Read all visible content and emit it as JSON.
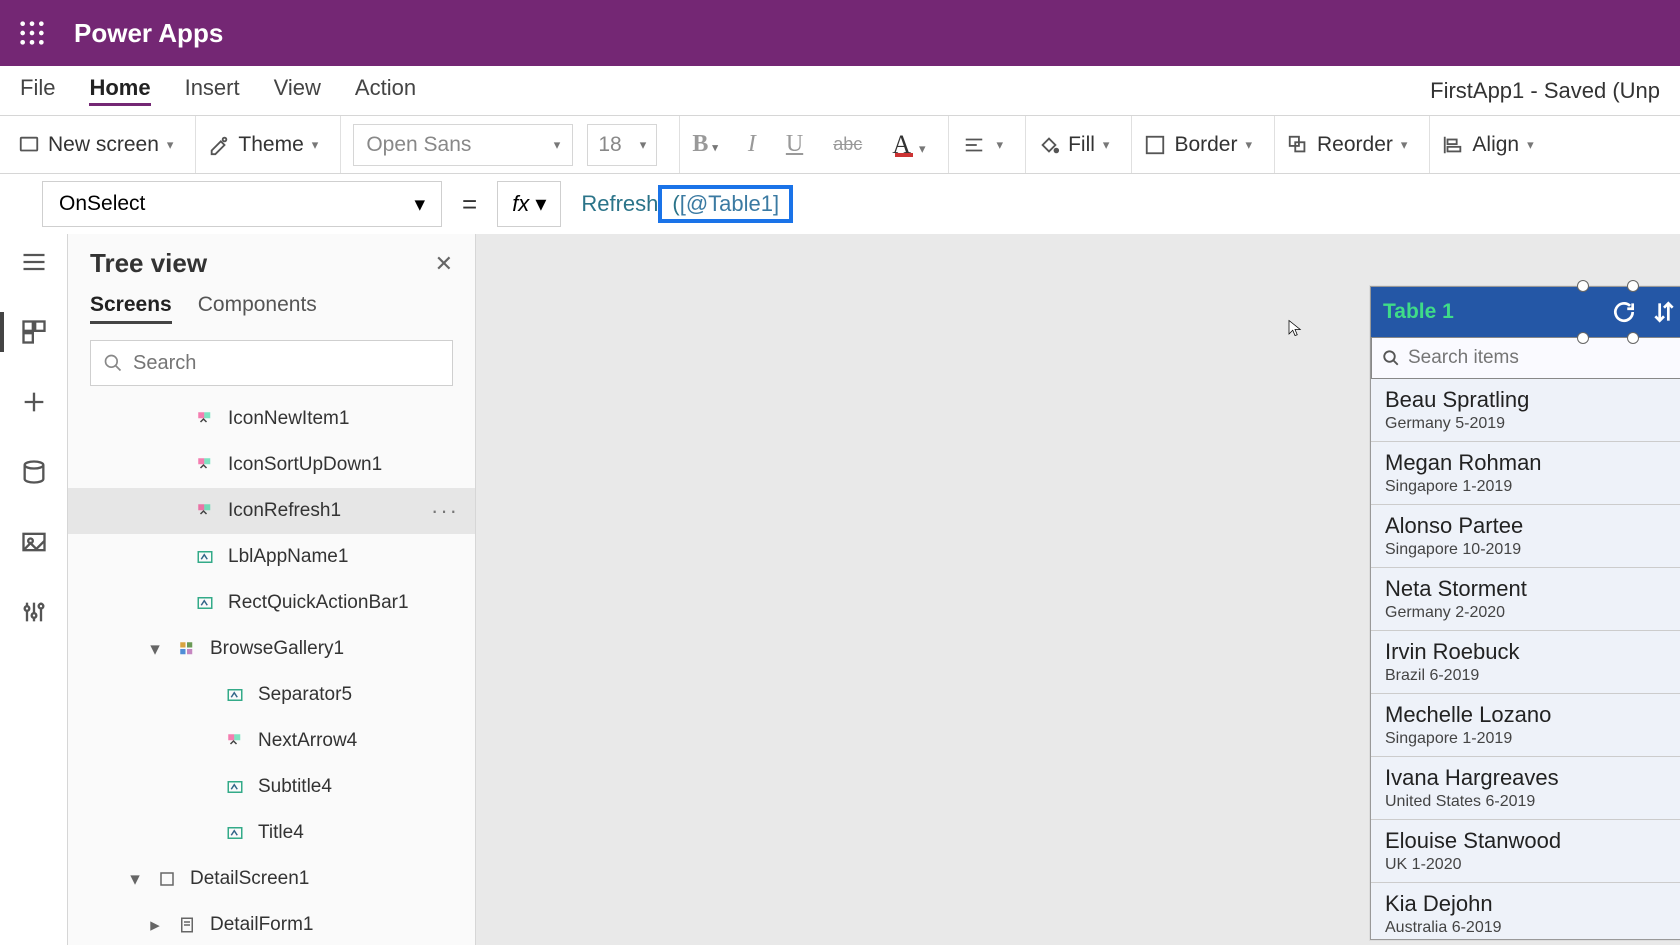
{
  "topbar": {
    "title": "Power Apps"
  },
  "menu": {
    "items": [
      "File",
      "Home",
      "Insert",
      "View",
      "Action"
    ],
    "active_index": 1,
    "app_state": "FirstApp1 - Saved (Unp"
  },
  "ribbon": {
    "new_screen": "New screen",
    "theme": "Theme",
    "font_name": "Open Sans",
    "font_size": "18",
    "fill": "Fill",
    "border": "Border",
    "reorder": "Reorder",
    "align": "Align"
  },
  "formula": {
    "property": "OnSelect",
    "fx": "fx",
    "func": "Refresh",
    "param_open": "(",
    "param": "[@Table1]",
    "param_close": ""
  },
  "tree": {
    "title": "Tree view",
    "tabs": [
      "Screens",
      "Components"
    ],
    "active_tab": 0,
    "search_placeholder": "Search",
    "nodes": [
      {
        "label": "IconNewItem1",
        "type": "icon",
        "depth": "depth1b"
      },
      {
        "label": "IconSortUpDown1",
        "type": "icon",
        "depth": "depth1b"
      },
      {
        "label": "IconRefresh1",
        "type": "icon",
        "depth": "depth1b",
        "selected": true
      },
      {
        "label": "LblAppName1",
        "type": "label",
        "depth": "depth1b"
      },
      {
        "label": "RectQuickActionBar1",
        "type": "label",
        "depth": "depth1b"
      },
      {
        "label": "BrowseGallery1",
        "type": "gallery",
        "depth": "depth1",
        "expand": true
      },
      {
        "label": "Separator5",
        "type": "label",
        "depth": "depth2"
      },
      {
        "label": "NextArrow4",
        "type": "icon",
        "depth": "depth2"
      },
      {
        "label": "Subtitle4",
        "type": "label",
        "depth": "depth2"
      },
      {
        "label": "Title4",
        "type": "label",
        "depth": "depth2"
      },
      {
        "label": "DetailScreen1",
        "type": "screen",
        "depth": "screen",
        "expand": true
      },
      {
        "label": "DetailForm1",
        "type": "form",
        "depth": "depth1",
        "collapsed": true
      }
    ]
  },
  "phone": {
    "title": "Table 1",
    "search_placeholder": "Search items",
    "items": [
      {
        "name": "Beau Spratling",
        "sub": "Germany 5-2019"
      },
      {
        "name": "Megan Rohman",
        "sub": "Singapore 1-2019"
      },
      {
        "name": "Alonso Partee",
        "sub": "Singapore 10-2019"
      },
      {
        "name": "Neta Storment",
        "sub": "Germany 2-2020"
      },
      {
        "name": "Irvin Roebuck",
        "sub": "Brazil 6-2019"
      },
      {
        "name": "Mechelle Lozano",
        "sub": "Singapore 1-2019"
      },
      {
        "name": "Ivana Hargreaves",
        "sub": "United States 6-2019"
      },
      {
        "name": "Elouise Stanwood",
        "sub": "UK 1-2020"
      },
      {
        "name": "Kia Dejohn",
        "sub": "Australia 6-2019"
      }
    ]
  }
}
